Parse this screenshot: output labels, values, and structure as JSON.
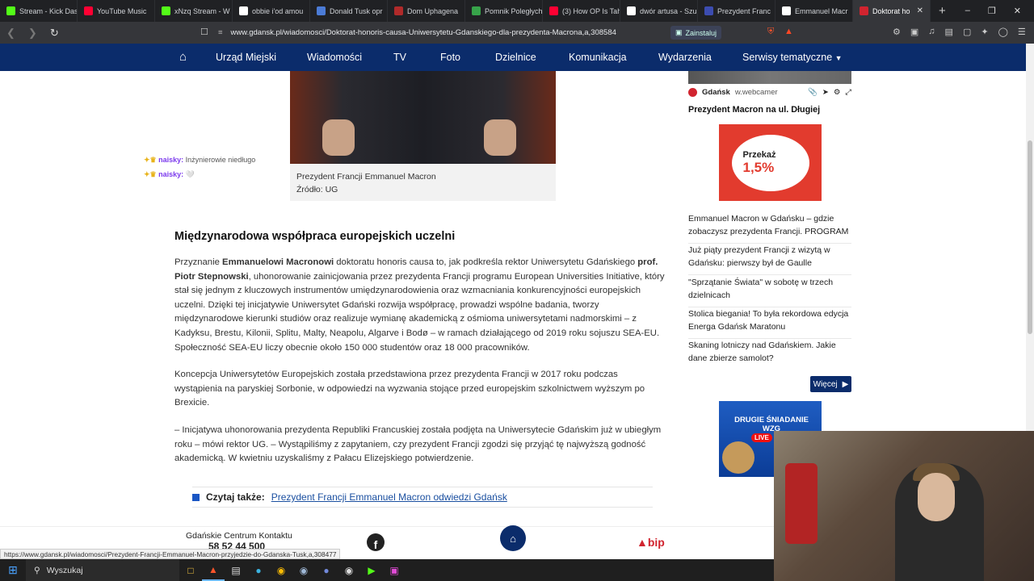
{
  "browser": {
    "tabs": [
      {
        "title": "Stream - Kick Das",
        "color": "#53fc18"
      },
      {
        "title": "YouTube Music",
        "color": "#ff0033"
      },
      {
        "title": "xNzq Stream - W",
        "color": "#53fc18"
      },
      {
        "title": "obbie i'od amou",
        "color": "#ffffff"
      },
      {
        "title": "Donald Tusk opr",
        "color": "#4b7bd6"
      },
      {
        "title": "Dom Uphagena",
        "color": "#b02a2a"
      },
      {
        "title": "Pomnik Poległych",
        "color": "#37a34a"
      },
      {
        "title": "(3) How OP Is Tah",
        "color": "#ff0033"
      },
      {
        "title": "dwór artusa - Szu",
        "color": "#ffffff"
      },
      {
        "title": "Prezydent Franc",
        "color": "#3c4cb0"
      },
      {
        "title": "Emmanuel Macr",
        "color": "#ffffff"
      },
      {
        "title": "Doktorat ho",
        "color": "#d1242f",
        "active": true
      }
    ],
    "new_tab": "+",
    "url": "www.gdansk.pl/wiadomosci/Doktorat-honoris-causa-Uniwersytetu-Gdanskiego-dla-prezydenta-Macrona,a,308584",
    "install_label": "Zainstaluj",
    "status_url": "https://www.gdansk.pl/wiadomosci/Prezydent-Francji-Emmanuel-Macron-przyjedzie-do-Gdanska-Tusk,a,308477"
  },
  "site_nav": {
    "items": [
      "Urząd Miejski",
      "Wiadomości",
      "TV",
      "Foto",
      "Dzielnice",
      "Komunikacja",
      "Wydarzenia",
      "Serwisy tematyczne"
    ]
  },
  "article": {
    "caption_line1": "Prezydent Francji Emmanuel Macron",
    "caption_line2": "Źródło: UG",
    "heading": "Międzynarodowa współpraca europejskich uczelni",
    "p1_pre": "Przyznanie ",
    "p1_b1": "Emmanuelowi Macronowi",
    "p1_mid": " doktoratu honoris causa to, jak podkreśla rektor Uniwersytetu Gdańskiego ",
    "p1_b2": "prof. Piotr Stepnowski",
    "p1_post": ", uhonorowanie zainicjowania przez prezydenta Francji programu European Universities Initiative, który stał się jednym z kluczowych instrumentów umiędzynarodowienia oraz wzmacniania konkurencyjności europejskich uczelni. Dzięki tej inicjatywie Uniwersytet Gdański rozwija współpracę, prowadzi wspólne badania, tworzy międzynarodowe kierunki studiów oraz realizuje wymianę akademicką z ośmioma uniwersytetami nadmorskimi – z Kadyksu, Brestu, Kilonii, Splitu, Malty, Neapolu, Algarve i Bodø – w ramach działającego od 2019 roku sojuszu SEA-EU. Społeczność SEA-EU liczy obecnie około 150 000 studentów oraz 18 000 pracowników.",
    "p2": "Koncepcja Uniwersytetów Europejskich została przedstawiona przez prezydenta Francji w 2017 roku podczas wystąpienia na paryskiej Sorbonie, w odpowiedzi na wyzwania stojące przed europejskim szkolnictwem wyższym po Brexicie.",
    "p3": "– Inicjatywa uhonorowania prezydenta Republiki Francuskiej została podjęta na Uniwersytecie Gdańskim już w ubiegłym roku – mówi rektor UG. – Wystąpiliśmy z zapytaniem, czy prezydent Francji zgodzi się przyjąć tę najwyższą godność akademicką. W kwietniu uzyskaliśmy z Pałacu Elizejskiego potwierdzenie.",
    "read_also_label": "Czytaj także:",
    "read_also_link": "Prezydent Francji Emmanuel Macron odwiedzi Gdańsk"
  },
  "chat_overlay": [
    {
      "user": "naisky:",
      "msg": "Inżynierowie niedługo"
    },
    {
      "user": "naisky:",
      "msg": "🤍"
    }
  ],
  "sidebar": {
    "cam_source": "Gdańsk",
    "cam_site": "w.webcamer",
    "title": "Prezydent Macron na ul. Długiej",
    "ad1_line1": "Przekaż",
    "ad1_line2": "1,5%",
    "links": [
      "Emmanuel Macron w Gdańsku – gdzie zobaczysz prezydenta Francji. PROGRAM",
      "Już piąty prezydent Francji z wizytą w Gdańsku: pierwszy był de Gaulle",
      "\"Sprzątanie Świata\" w sobotę w trzech dzielnicach",
      "Stolica biegania! To była rekordowa edycja Energa Gdańsk Maratonu",
      "Skaning lotniczy nad Gdańskiem. Jakie dane zbierze samolot?"
    ],
    "more_label": "Więcej",
    "ad2_title": "DRUGIE ŚNIADANIE WZG",
    "ad2_live": "LIVE"
  },
  "footer": {
    "contact_center": "Gdańskie Centrum Kontaktu",
    "phone": "58 52 44 500",
    "bip": "bip"
  },
  "taskbar": {
    "search_placeholder": "Wyszukaj"
  }
}
